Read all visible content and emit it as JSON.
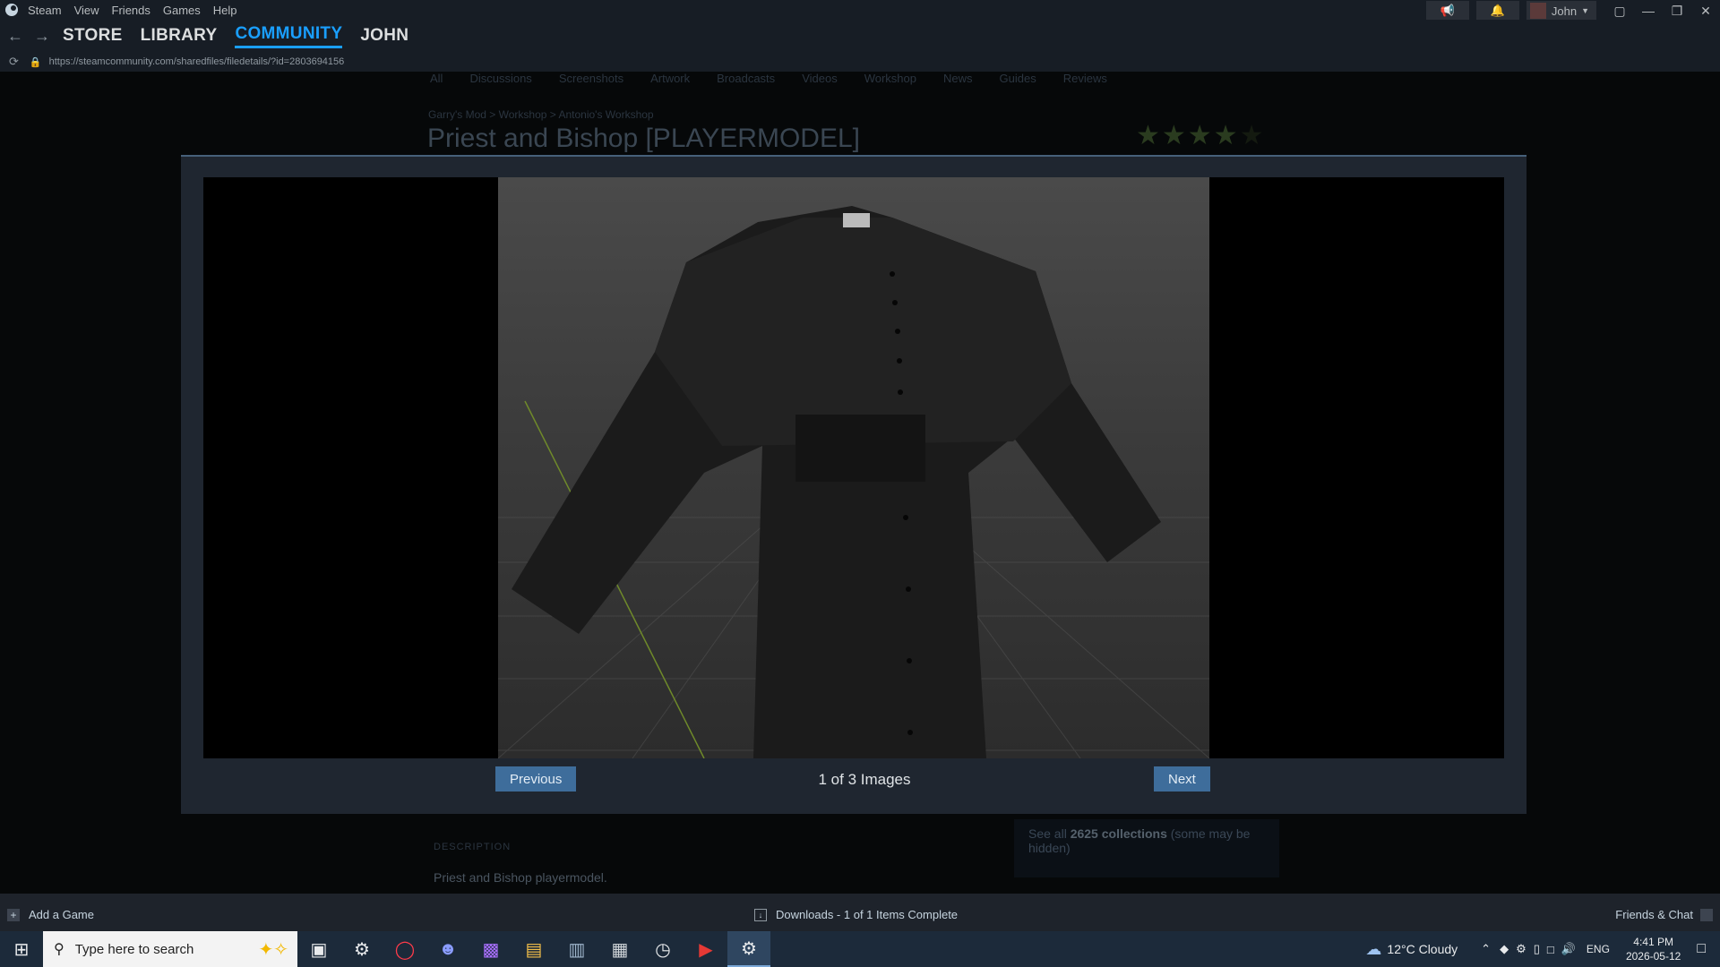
{
  "menu": {
    "app_name": "Steam",
    "items": [
      "View",
      "Friends",
      "Games",
      "Help"
    ]
  },
  "account": {
    "name": "John"
  },
  "nav": {
    "links": [
      "STORE",
      "LIBRARY",
      "COMMUNITY",
      "JOHN"
    ],
    "active": "COMMUNITY"
  },
  "url": "https://steamcommunity.com/sharedfiles/filedetails/?id=2803694156",
  "background_page": {
    "subnav": [
      "All",
      "Discussions",
      "Screenshots",
      "Artwork",
      "Broadcasts",
      "Videos",
      "Workshop",
      "News",
      "Guides",
      "Reviews"
    ],
    "breadcrumb": "Garry's Mod > Workshop > Antonio's Workshop",
    "title": "Priest and Bishop [PLAYERMODEL]",
    "rating_stars": 4,
    "description_heading": "DESCRIPTION",
    "description_text": "Priest and Bishop playermodel.",
    "collections_prefix": "See all",
    "collections_count": "2625 collections",
    "collections_suffix": "(some may be hidden)"
  },
  "modal": {
    "previous_label": "Previous",
    "next_label": "Next",
    "counter": "1 of 3 Images"
  },
  "bottombar": {
    "add_game": "Add a Game",
    "downloads": "Downloads - 1 of 1 Items Complete",
    "friends_chat": "Friends & Chat"
  },
  "taskbar": {
    "search_placeholder": "Type here to search",
    "weather": "12°C  Cloudy",
    "language": "ENG",
    "time": "4:41 PM",
    "date": "2026-05-12"
  }
}
